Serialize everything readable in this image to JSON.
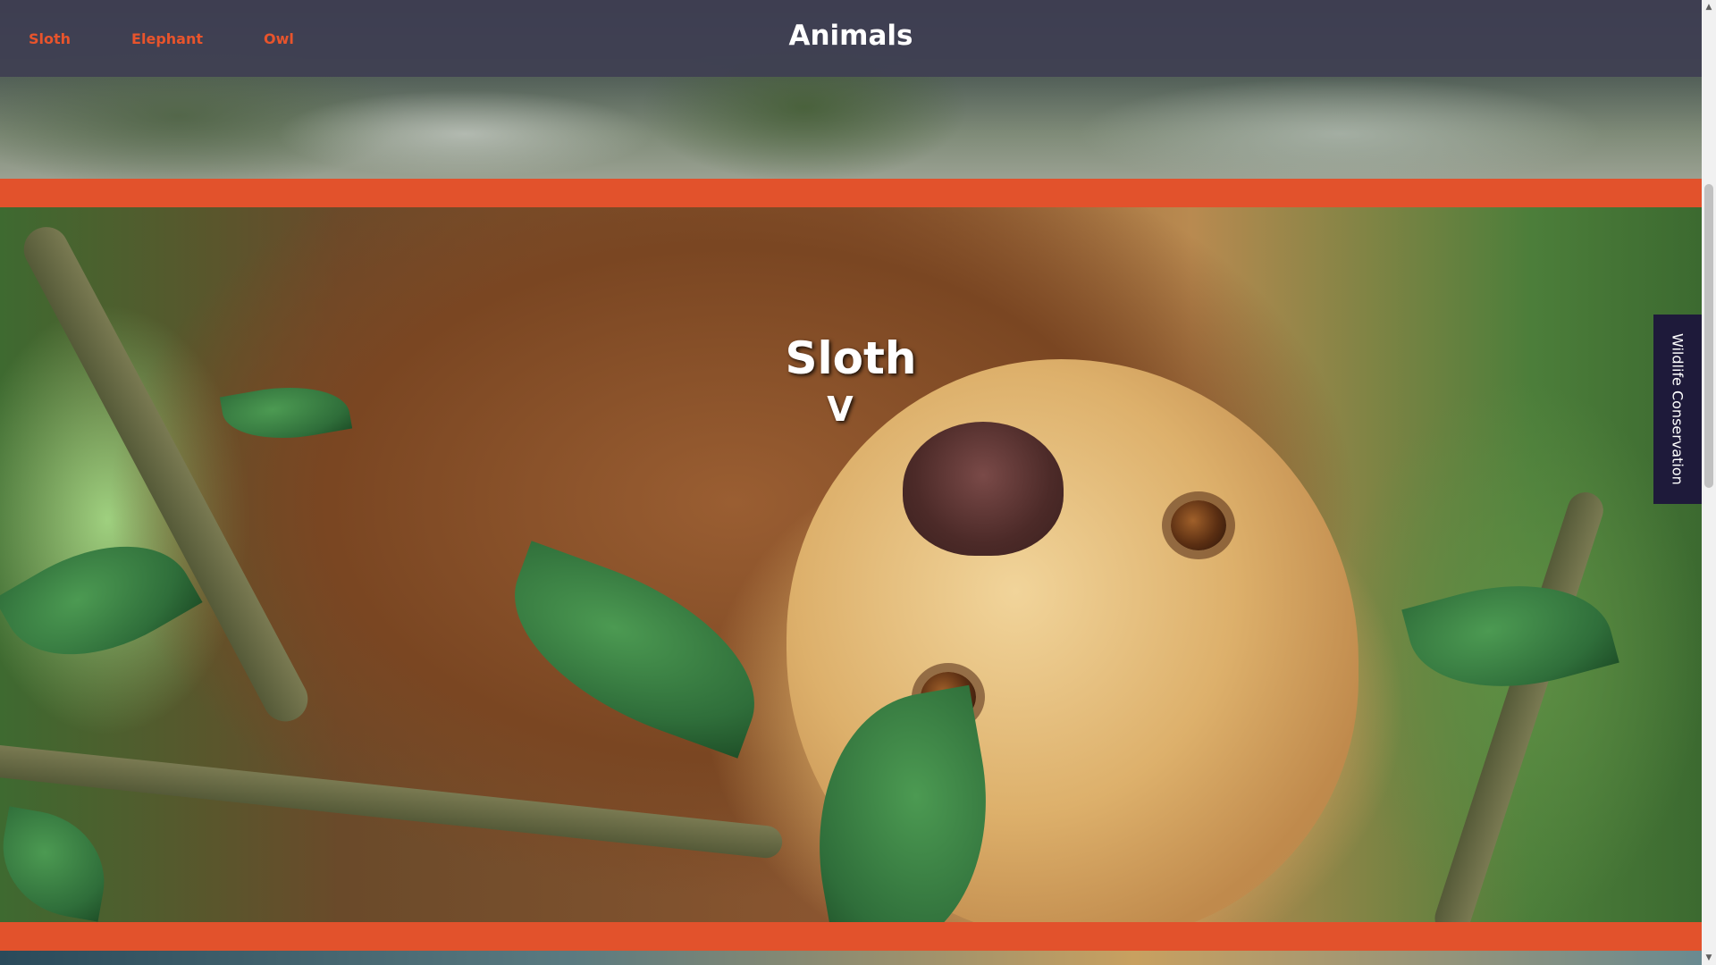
{
  "navbar": {
    "links": [
      {
        "label": "Sloth"
      },
      {
        "label": "Elephant"
      },
      {
        "label": "Owl"
      }
    ],
    "title": "Animals"
  },
  "hero": {
    "title": "Sloth",
    "chevron": "V",
    "image_icon": "sloth-photo"
  },
  "side_tab": {
    "label": "Wildlife Conservation"
  },
  "colors": {
    "accent": "#e2522c",
    "nav_link": "#e8542c",
    "navbar_bg": "#3e3e52",
    "side_tab_bg": "#1e1a3a"
  },
  "scrollbar": {
    "up_icon": "triangle-up-icon",
    "down_icon": "triangle-down-icon"
  }
}
